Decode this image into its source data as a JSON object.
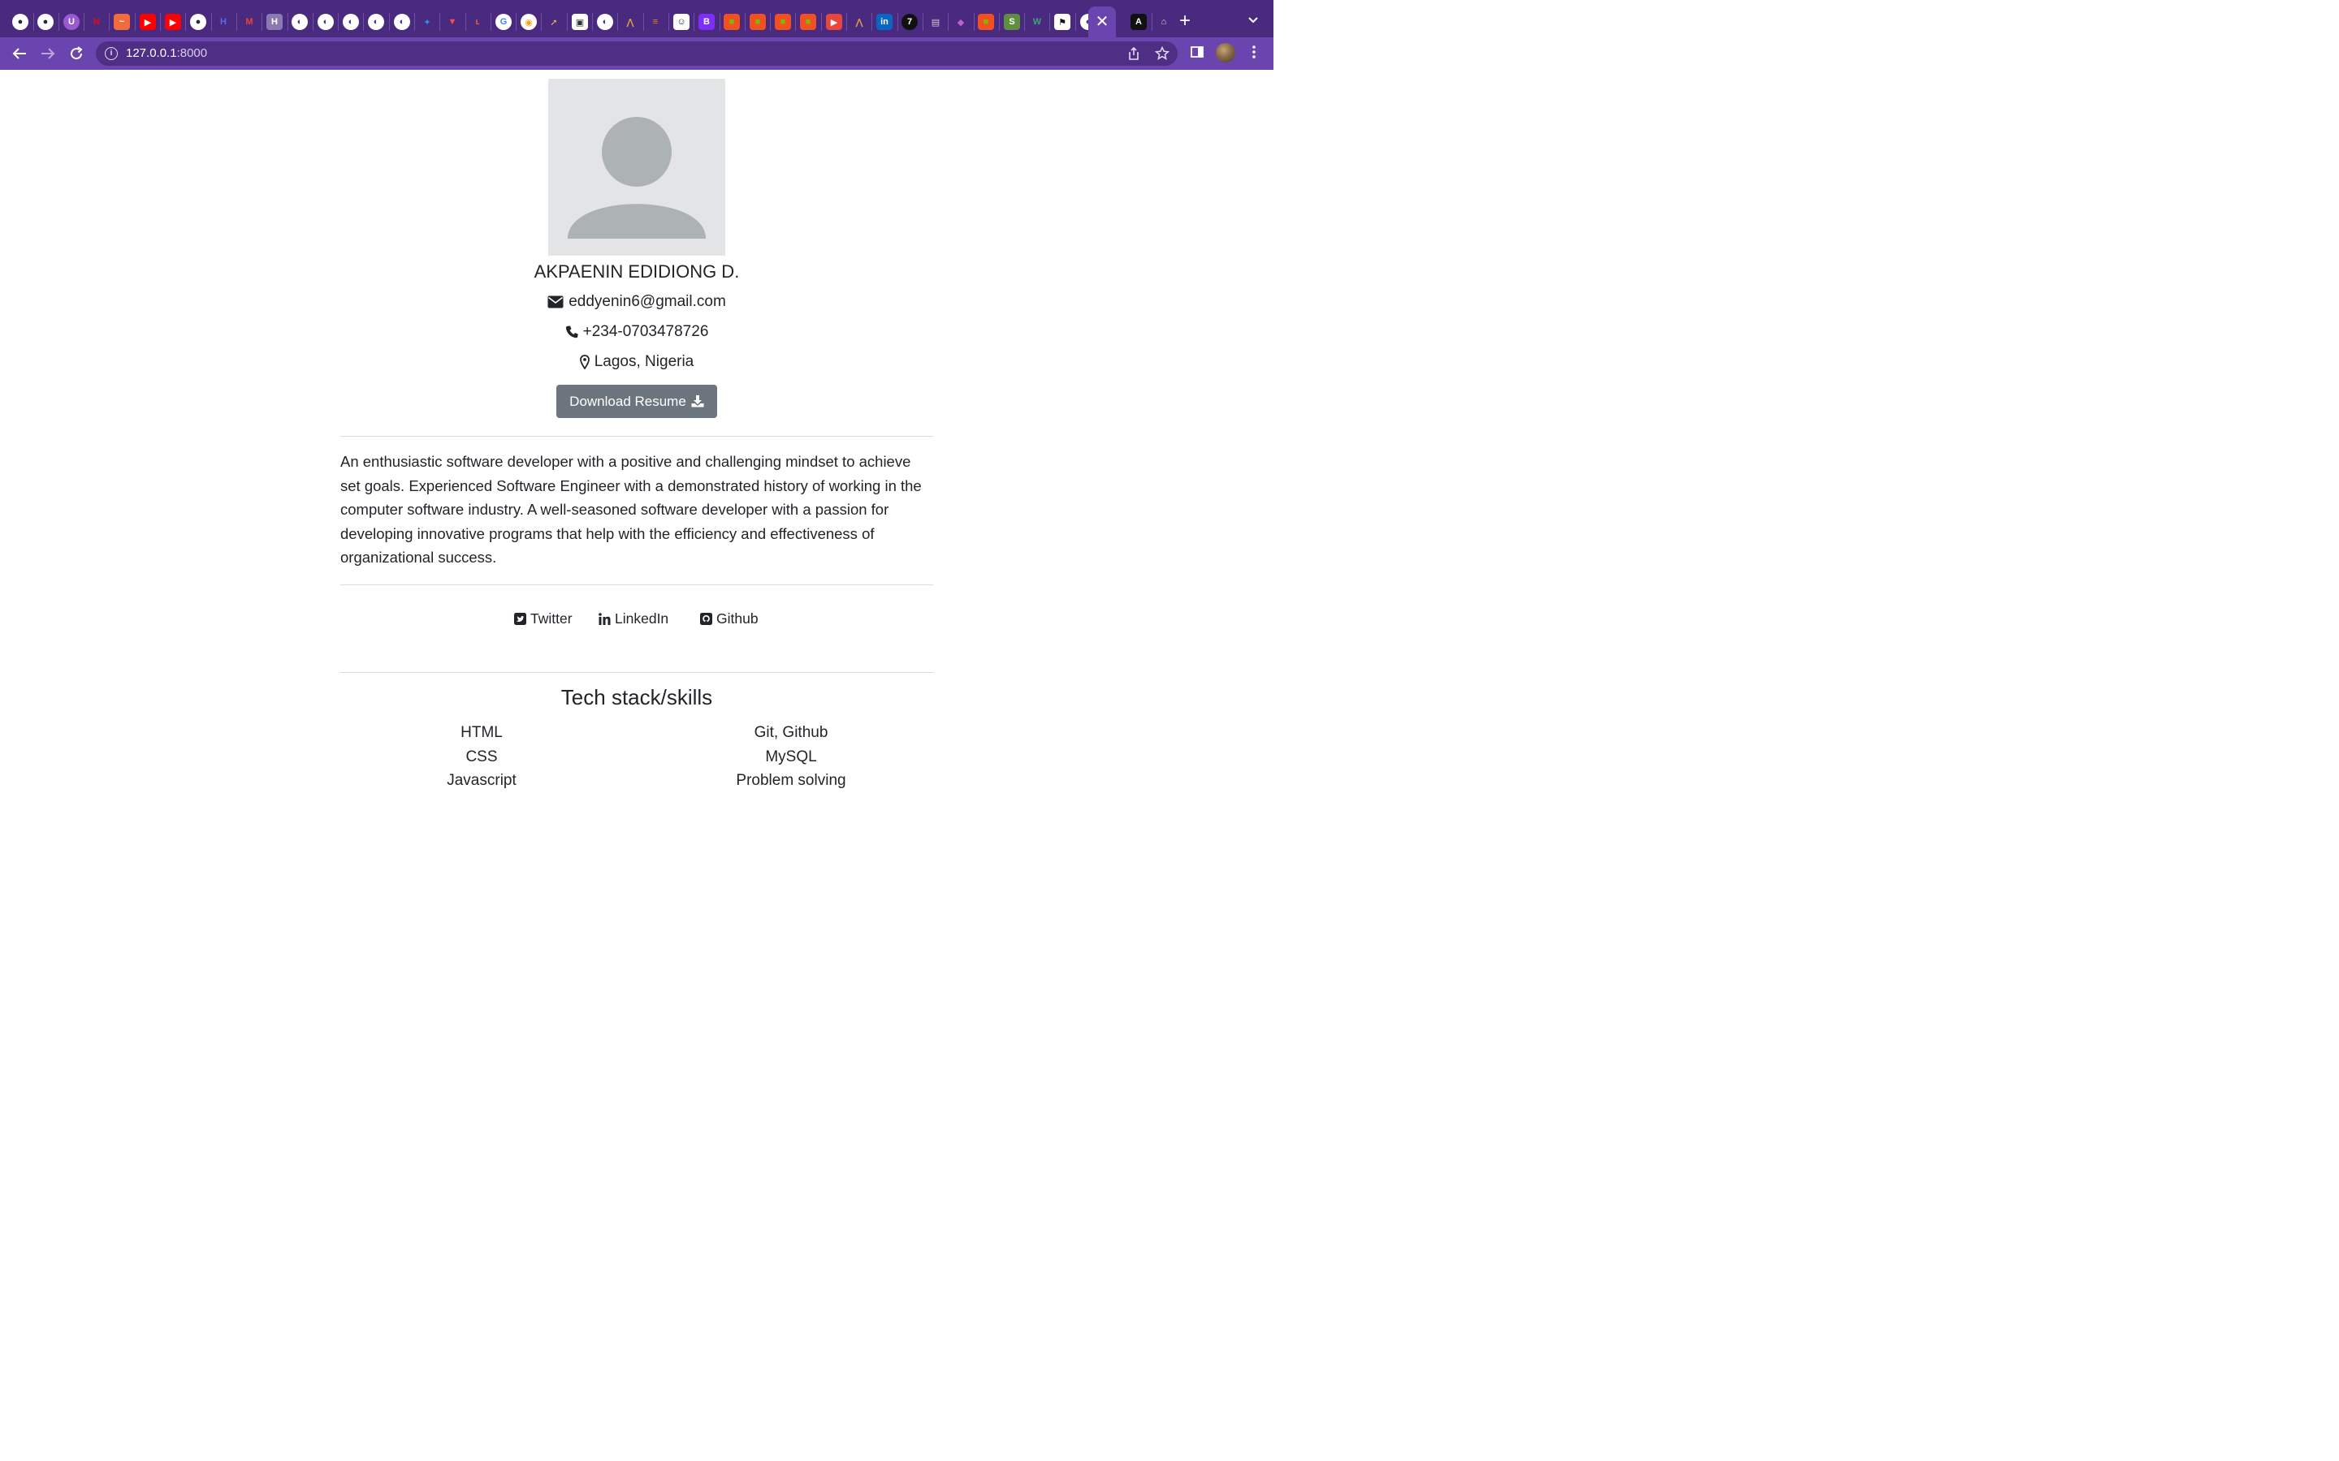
{
  "browser": {
    "url_host": "127.0.0.1",
    "url_port": ":8000",
    "theme_color": "#6a45b0",
    "tabstrip_color": "#4a2a7e",
    "favicons": [
      "github-icon",
      "github-icon",
      "upwork-icon",
      "netflix-icon",
      "chart-icon",
      "youtube-icon",
      "youtube-icon",
      "github-icon",
      "hashnode-icon",
      "gmail-icon",
      "h-icon",
      "globe-icon",
      "globe-icon",
      "globe-icon",
      "globe-icon",
      "globe-icon",
      "twitter-icon",
      "vue-icon",
      "laravel-icon",
      "google-icon",
      "circle-icon",
      "rocket-icon",
      "board-icon",
      "globe-icon",
      "abuja-icon",
      "stack-icon",
      "robot-icon",
      "bootstrap-icon",
      "microsoft-icon",
      "microsoft-icon",
      "microsoft-icon",
      "microsoft-icon",
      "play-icon",
      "abuja-icon",
      "linkedin-icon",
      "seven-icon",
      "bm-icon",
      "diamond-icon",
      "microsoft-icon",
      "shopify-icon",
      "webflow-icon",
      "flag-icon",
      "globe-icon",
      "active-tab",
      "angular-icon",
      "bank-icon"
    ]
  },
  "profile": {
    "name": "AKPAENIN EDIDIONG D.",
    "email": "eddyenin6@gmail.com",
    "phone": "+234-0703478726",
    "location": "Lagos, Nigeria",
    "download_label": "Download Resume"
  },
  "about": "An enthusiastic software developer with a positive and challenging mindset to achieve set goals. Experienced Software Engineer with a demonstrated history of working in the computer software industry. A well-seasoned software developer with a passion for developing innovative programs that help with the efficiency and effectiveness of organizational success.",
  "social": {
    "twitter": "Twitter",
    "linkedin": "LinkedIn",
    "github": "Github"
  },
  "skills": {
    "title": "Tech stack/skills",
    "left": [
      "HTML",
      "CSS",
      "Javascript"
    ],
    "right": [
      "Git, Github",
      "MySQL",
      "Problem solving"
    ]
  }
}
